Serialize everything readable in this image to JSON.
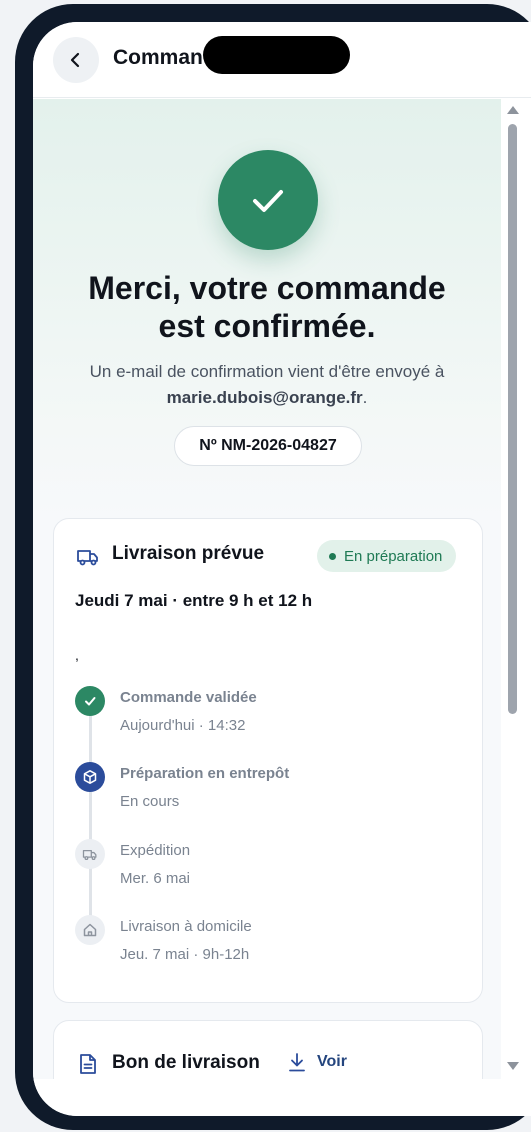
{
  "header": {
    "title": "Comman",
    "back_icon": "chevron-left-icon"
  },
  "confirmation": {
    "icon": "check-icon",
    "title_line1": "Merci, votre commande",
    "title_line2": "est confirmée.",
    "subtitle_prefix": "Un e-mail de confirmation vient d'être envoyé à",
    "email": "marie.dubois@orange.fr",
    "subtitle_suffix": ".",
    "order_number": "Nº NM-2026-04827"
  },
  "delivery": {
    "icon": "truck-icon",
    "title": "Livraison prévue",
    "status": "En préparation",
    "date": "Jeudi 7 mai · entre 9 h et 12 h",
    "note": ",",
    "steps": [
      {
        "title": "Commande validée",
        "sub": "Aujourd'hui · 14:32",
        "icon": "check-icon",
        "state": "done"
      },
      {
        "title": "Préparation en entrepôt",
        "sub": "En cours",
        "icon": "box-icon",
        "state": "current"
      },
      {
        "title": "Expédition",
        "sub": "Mer. 6 mai",
        "icon": "truck-icon",
        "state": "pending"
      },
      {
        "title": "Livraison à domicile",
        "sub": "Jeu. 7 mai · 9h-12h",
        "icon": "home-icon",
        "state": "pending"
      }
    ]
  },
  "delivery_note": {
    "icon": "document-icon",
    "title": "Bon de livraison",
    "action_icon": "download-icon",
    "action_label": "Voir"
  },
  "colors": {
    "accent_green": "#2c8864",
    "navy": "#2b4c9b",
    "text": "#10141c"
  }
}
